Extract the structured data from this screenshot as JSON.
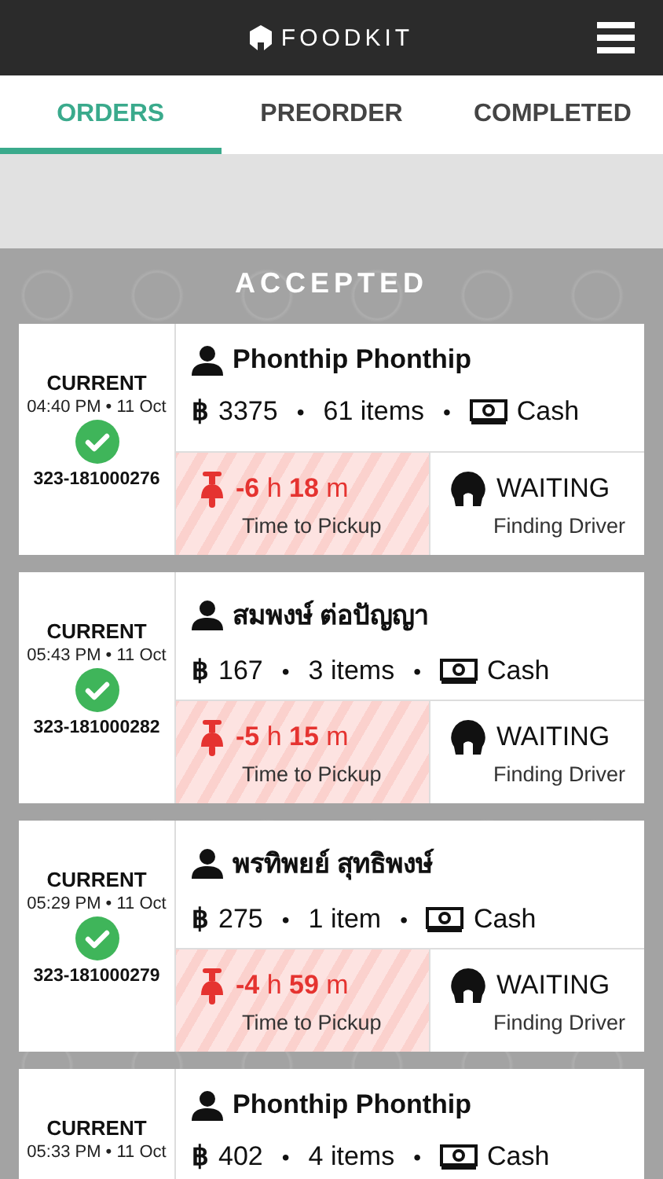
{
  "header": {
    "logo": "FOODKIT"
  },
  "tabs": [
    {
      "label": "ORDERS",
      "selected": true
    },
    {
      "label": "PREORDER",
      "selected": false
    },
    {
      "label": "COMPLETED",
      "selected": false
    }
  ],
  "section_title": "ACCEPTED",
  "orders": [
    {
      "status": "CURRENT",
      "time": "04:40 PM • 11 Oct",
      "order_no": "323-181000276",
      "customer": "Phonthip Phonthip",
      "currency": "฿",
      "total": "3375",
      "separator": "•",
      "items": "61 items",
      "payment": "Cash",
      "countdown": "**-6** h **18** m",
      "countdown_label": "Time to Pickup",
      "driver_status": "WAITING",
      "driver_label": "Finding Driver"
    },
    {
      "status": "CURRENT",
      "time": "05:43 PM • 11 Oct",
      "order_no": "323-181000282",
      "customer": "สมพงษ์ ต่อปัญญา",
      "currency": "฿",
      "total": "167",
      "separator": "•",
      "items": "3 items",
      "payment": "Cash",
      "countdown": "**-5** h **15** m",
      "countdown_label": "Time to Pickup",
      "driver_status": "WAITING",
      "driver_label": "Finding Driver"
    },
    {
      "status": "CURRENT",
      "time": "05:29 PM • 11 Oct",
      "order_no": "323-181000279",
      "customer": "พรทิพยย์ สุทธิพงษ์",
      "currency": "฿",
      "total": "275",
      "separator": "•",
      "items": "1 item",
      "payment": "Cash",
      "countdown": "**-4** h **59** m",
      "countdown_label": "Time to Pickup",
      "driver_status": "WAITING",
      "driver_label": "Finding Driver"
    },
    {
      "status": "CURRENT",
      "time": "05:33 PM • 11 Oct",
      "customer": "Phonthip Phonthip",
      "currency": "฿",
      "total": "402",
      "separator": "•",
      "items": "4 items",
      "payment": "Cash"
    }
  ]
}
